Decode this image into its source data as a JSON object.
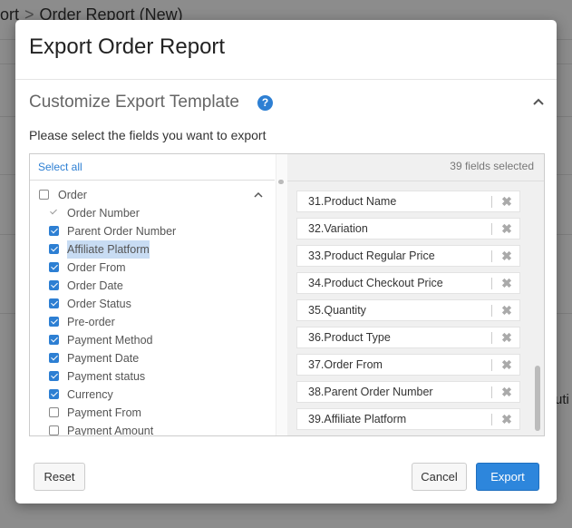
{
  "background": {
    "breadcrumb_parent": "ort",
    "breadcrumb_separator": ">",
    "breadcrumb_current": "Order Report (New)",
    "side_text": "uti"
  },
  "modal": {
    "title": "Export Order Report",
    "section_title": "Customize Export Template",
    "help_icon": "question-circle-icon",
    "collapse_icon": "chevron-up-icon",
    "instructions": "Please select the fields you want to export",
    "select_all": "Select all",
    "fields_selected": "39 fields selected",
    "tree": {
      "group": {
        "label": "Order",
        "checked": false
      },
      "items": [
        {
          "label": "Order Number",
          "state": "disabled-checked"
        },
        {
          "label": "Parent Order Number",
          "state": "checked"
        },
        {
          "label": "Affiliate Platform",
          "state": "checked",
          "highlight": true
        },
        {
          "label": "Order From",
          "state": "checked"
        },
        {
          "label": "Order Date",
          "state": "checked"
        },
        {
          "label": "Order Status",
          "state": "checked"
        },
        {
          "label": "Pre-order",
          "state": "checked"
        },
        {
          "label": "Payment Method",
          "state": "checked"
        },
        {
          "label": "Payment Date",
          "state": "checked"
        },
        {
          "label": "Payment status",
          "state": "checked"
        },
        {
          "label": "Currency",
          "state": "checked"
        },
        {
          "label": "Payment From",
          "state": "unchecked"
        },
        {
          "label": "Payment Amount",
          "state": "unchecked"
        }
      ]
    },
    "selected_fields": [
      "31.Product Name",
      "32.Variation",
      "33.Product Regular Price",
      "34.Product Checkout Price",
      "35.Quantity",
      "36.Product Type",
      "37.Order From",
      "38.Parent Order Number",
      "39.Affiliate Platform"
    ],
    "remove_glyph": "✖",
    "buttons": {
      "reset": "Reset",
      "cancel": "Cancel",
      "export": "Export"
    }
  },
  "colors": {
    "accent": "#2d7fd3",
    "primary_button": "#2d86dc"
  }
}
